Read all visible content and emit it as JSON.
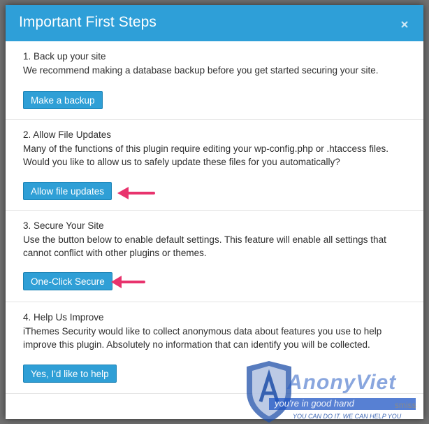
{
  "modal": {
    "title": "Important First Steps",
    "close_label": "×"
  },
  "sections": [
    {
      "title": "1. Back up your site",
      "description": "We recommend making a database backup before you get started securing your site.",
      "button_label": "Make a backup"
    },
    {
      "title": "2. Allow File Updates",
      "description": "Many of the functions of this plugin require editing your wp-config.php or .htaccess files. Would you like to allow us to safely update these files for you automatically?",
      "button_label": "Allow file updates"
    },
    {
      "title": "3. Secure Your Site",
      "description": "Use the button below to enable default settings. This feature will enable all settings that cannot conflict with other plugins or themes.",
      "button_label": "One-Click Secure"
    },
    {
      "title": "4. Help Us Improve",
      "description": "iThemes Security would like to collect anonymous data about features you use to help improve this plugin. Absolutely no information that can identify you will be collected.",
      "button_label": "Yes, I'd like to help"
    }
  ],
  "watermark": {
    "brand": "AnonyViet",
    "tagline": "you're in good hand",
    "slogan": "YOU CAN DO IT. WE CAN HELP YOU",
    "dismiss_fragment": "smiss"
  },
  "colors": {
    "header": "#2e9fd8",
    "button": "#2f9fd6",
    "arrow": "#e8336d"
  }
}
